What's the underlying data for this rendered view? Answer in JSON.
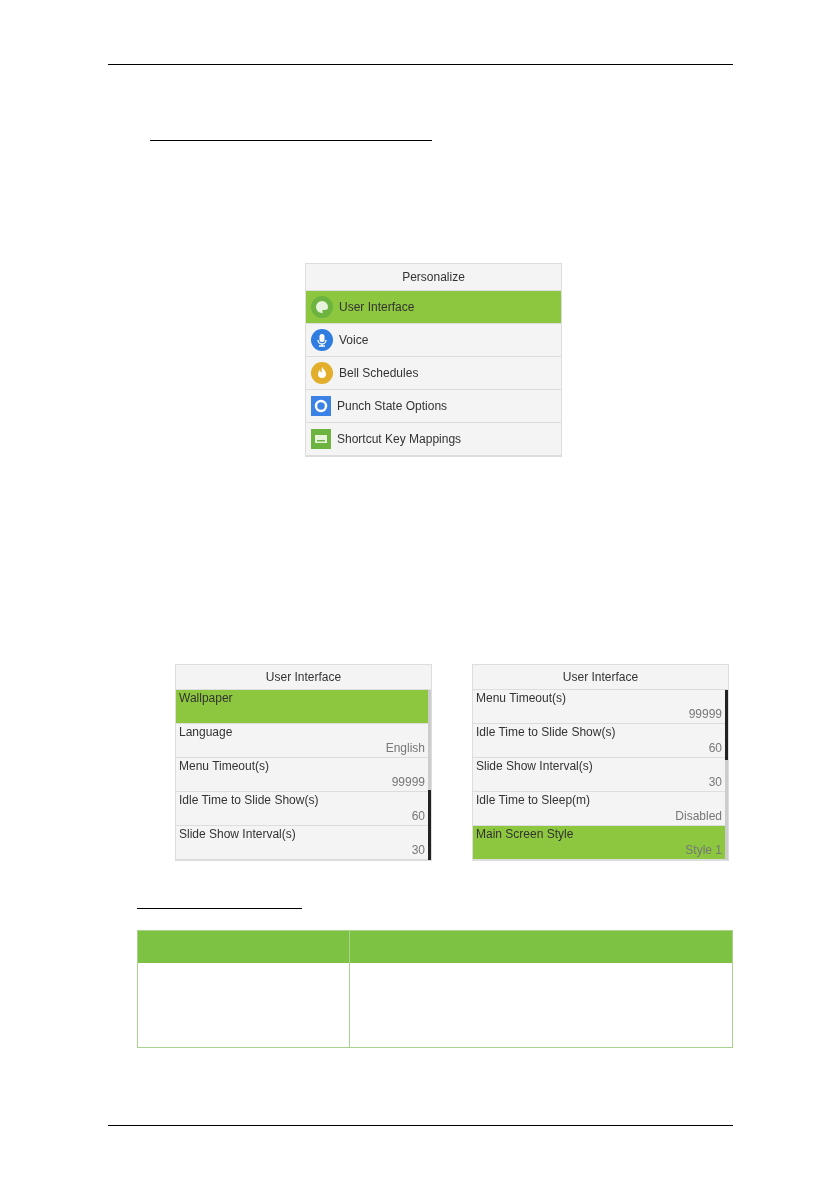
{
  "personalize_menu": {
    "title": "Personalize",
    "items": [
      {
        "label": "User Interface",
        "selected": true
      },
      {
        "label": "Voice",
        "selected": false
      },
      {
        "label": "Bell Schedules",
        "selected": false
      },
      {
        "label": "Punch State Options",
        "selected": false
      },
      {
        "label": "Shortcut Key Mappings",
        "selected": false
      }
    ]
  },
  "user_interface_screens": [
    {
      "title": "User Interface",
      "items": [
        {
          "label": "Wallpaper",
          "selected": true
        },
        {
          "label": "Language",
          "value": "English",
          "selected": false
        },
        {
          "label": "Menu Timeout(s)",
          "value": "99999",
          "selected": false
        },
        {
          "label": "Idle Time to Slide Show(s)",
          "value": "60",
          "selected": false
        },
        {
          "label": "Slide Show Interval(s)",
          "value": "30",
          "selected": false
        }
      ]
    },
    {
      "title": "User Interface",
      "items": [
        {
          "label": "Menu Timeout(s)",
          "value": "99999",
          "selected": false
        },
        {
          "label": "Idle Time to Slide Show(s)",
          "value": "60",
          "selected": false
        },
        {
          "label": "Slide Show Interval(s)",
          "value": "30",
          "selected": false
        },
        {
          "label": "Idle Time to Sleep(m)",
          "value": "Disabled",
          "selected": false
        },
        {
          "label": "Main Screen Style",
          "value": "Style 1",
          "selected": true
        }
      ]
    }
  ]
}
